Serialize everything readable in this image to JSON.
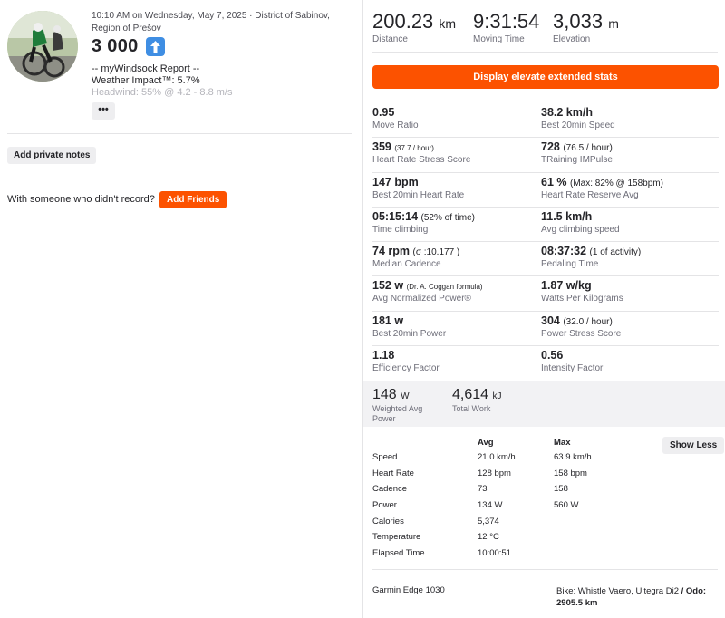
{
  "activity": {
    "meta": "10:10 AM on Wednesday, May 7, 2025 · District of Sabinov, Region of Prešov",
    "title": "3 000",
    "title_emoji": "up-arrow-emoji",
    "description_lines": [
      "-- myWindsock Report --",
      "Weather Impact™: 5.7%",
      "Headwind: 55% @ 4.2 - 8.8 m/s"
    ],
    "more_label": "•••",
    "private_notes_label": "Add private notes",
    "someone_text": "With someone who didn't record?",
    "add_friends_label": "Add Friends"
  },
  "top_stats": [
    {
      "value": "200.23",
      "unit": "km",
      "label": "Distance"
    },
    {
      "value": "9:31:54",
      "unit": "",
      "label": "Moving Time"
    },
    {
      "value": "3,033",
      "unit": "m",
      "label": "Elevation"
    }
  ],
  "cta_label": "Display elevate extended stats",
  "extended_stats": [
    [
      {
        "value": "0.95",
        "extra": "",
        "label": "Move Ratio"
      },
      {
        "value": "38.2 km/h",
        "extra": "",
        "label": "Best 20min Speed"
      }
    ],
    [
      {
        "value": "359",
        "extra": "(37.7 / hour)",
        "label": "Heart Rate Stress Score"
      },
      {
        "value": "728",
        "extra": "(76.5 / hour)",
        "label": "TRaining IMPulse"
      }
    ],
    [
      {
        "value": "147 bpm",
        "extra": "",
        "label": "Best 20min Heart Rate"
      },
      {
        "value": "61 %",
        "extra": "(Max: 82% @ 158bpm)",
        "label": "Heart Rate Reserve Avg"
      }
    ],
    [
      {
        "value": "05:15:14",
        "extra": "(52% of time)",
        "label": "Time climbing"
      },
      {
        "value": "11.5 km/h",
        "extra": "",
        "label": "Avg climbing speed"
      }
    ],
    [
      {
        "value": "74 rpm",
        "extra": "(σ :10.177 )",
        "label": "Median Cadence"
      },
      {
        "value": "08:37:32",
        "extra": "(1 of activity)",
        "label": "Pedaling Time"
      }
    ],
    [
      {
        "value": "152 w",
        "extra": "(Dr. A. Coggan formula)",
        "label": "Avg Normalized Power®"
      },
      {
        "value": "1.87 w/kg",
        "extra": "",
        "label": "Watts Per Kilograms"
      }
    ],
    [
      {
        "value": "181 w",
        "extra": "",
        "label": "Best 20min Power"
      },
      {
        "value": "304",
        "extra": "(32.0 / hour)",
        "label": "Power Stress Score"
      }
    ],
    [
      {
        "value": "1.18",
        "extra": "",
        "label": "Efficiency Factor"
      },
      {
        "value": "0.56",
        "extra": "",
        "label": "Intensity Factor"
      }
    ]
  ],
  "gray_stats": [
    {
      "value": "148",
      "unit": "W",
      "label_lines": [
        "Weighted Avg",
        "Power"
      ]
    },
    {
      "value": "4,614",
      "unit": "kJ",
      "label_lines": [
        "Total Work"
      ]
    }
  ],
  "detail_table": {
    "headers": [
      "",
      "Avg",
      "Max"
    ],
    "rows": [
      [
        "Speed",
        "21.0 km/h",
        "63.9 km/h"
      ],
      [
        "Heart Rate",
        "128 bpm",
        "158 bpm"
      ],
      [
        "Cadence",
        "73",
        "158"
      ],
      [
        "Power",
        "134 W",
        "560 W"
      ],
      [
        "Calories",
        "5,374",
        ""
      ],
      [
        "Temperature",
        "12 °C",
        ""
      ],
      [
        "Elapsed Time",
        "10:00:51",
        ""
      ]
    ],
    "show_less_label": "Show Less"
  },
  "device": "Garmin Edge 1030",
  "bike": {
    "prefix": "Bike: Whistle Vaero, Ultegra Di2",
    "odo_label": "/ Odo:",
    "odo_value": "2905.5 km"
  },
  "colors": {
    "accent": "#fc5200",
    "text": "#242428",
    "muted": "#6d6d78",
    "divider": "#e4e4e6",
    "panel": "#f2f2f4"
  }
}
